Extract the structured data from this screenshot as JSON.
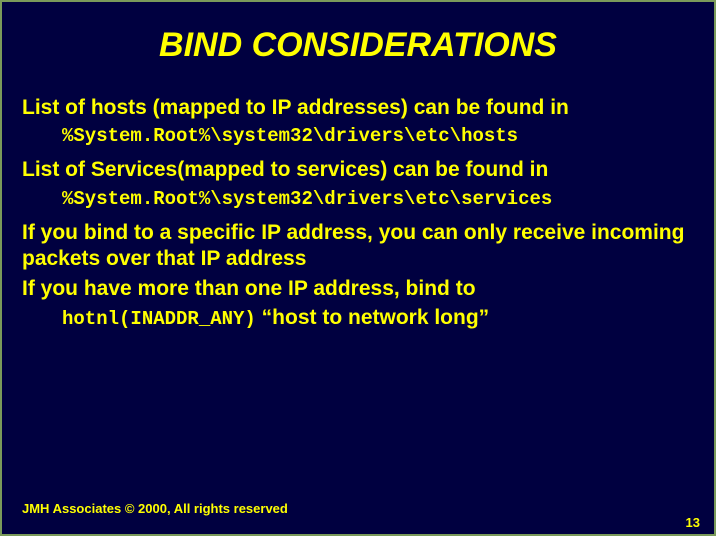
{
  "title": "BIND CONSIDERATIONS",
  "bullets": {
    "b1": "List of hosts (mapped to IP addresses) can be found in",
    "c1": "%System.Root%\\system32\\drivers\\etc\\hosts",
    "b2": "List of Services(mapped to services) can be found in",
    "c2": "%System.Root%\\system32\\drivers\\etc\\services",
    "b3": "If you bind to a specific IP address, you can only receive incoming packets over that IP address",
    "b4": "If you have more than one IP address, bind to",
    "c4_code": "hotnl(INADDR_ANY)",
    "c4_text": " “host to network long”"
  },
  "footer": "JMH Associates © 2000, All rights reserved",
  "page": "13"
}
